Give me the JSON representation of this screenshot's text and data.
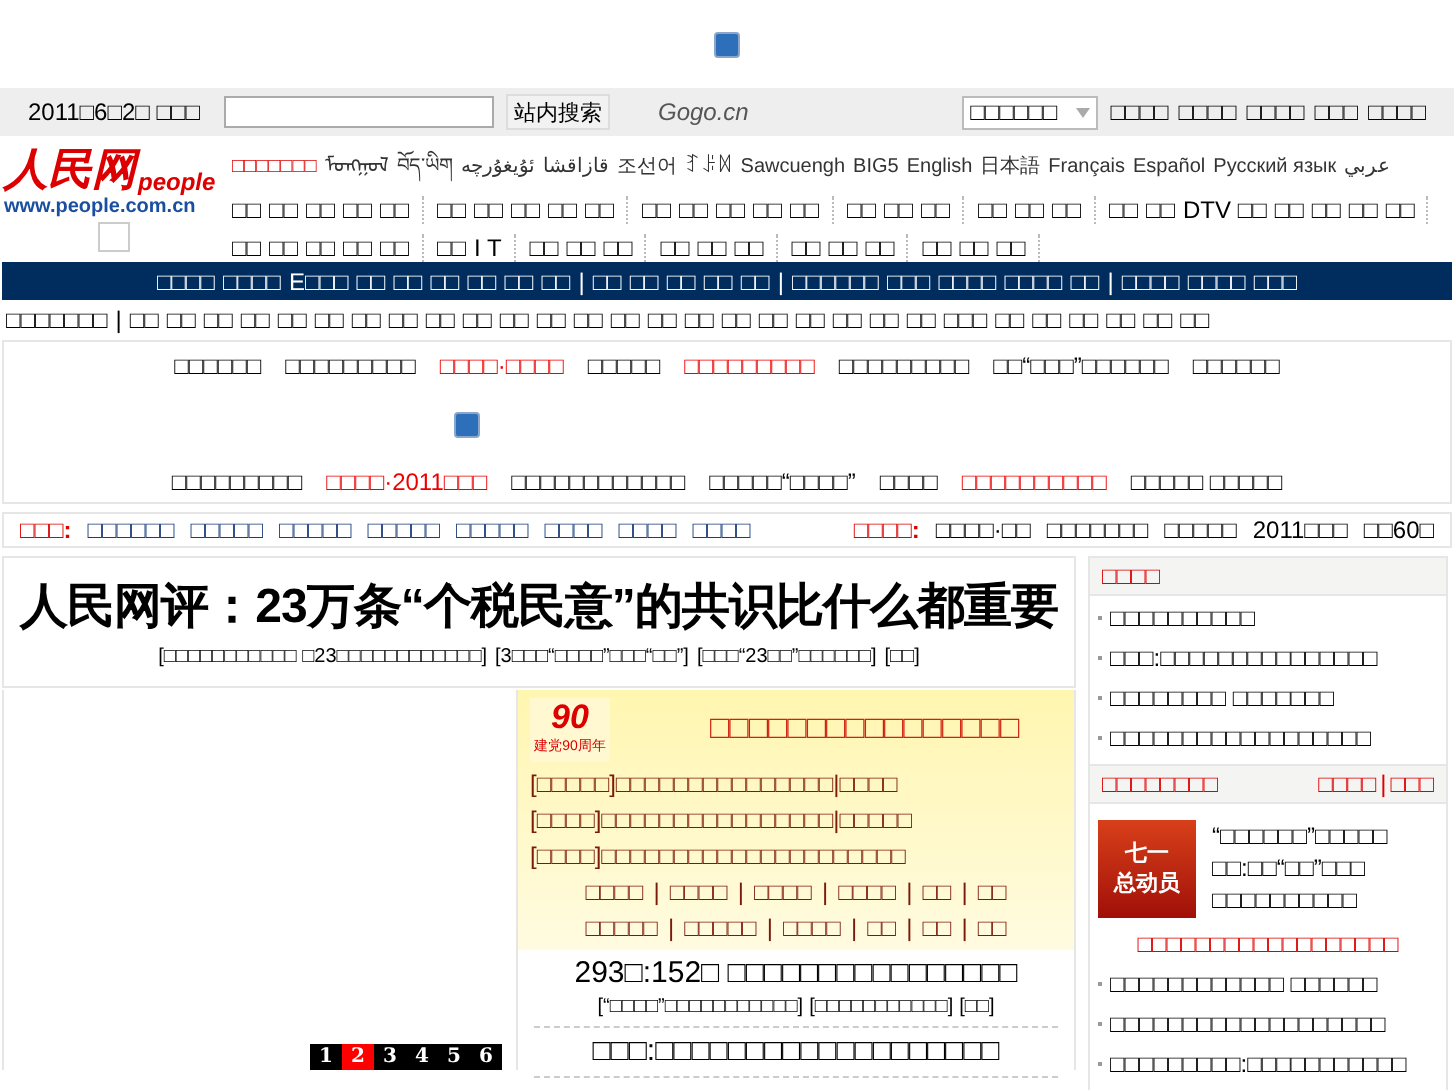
{
  "top_banner": {
    "broken_image": true
  },
  "utility_bar": {
    "date": "2011□6□2□ □□□",
    "search": {
      "button": "站内搜索"
    },
    "partner_logo": "Gogo.cn",
    "select": {
      "value": "□□□□□□"
    },
    "links": [
      "□□□□",
      "□□□□",
      "□□□□",
      "□□□",
      "□□□□"
    ]
  },
  "logo": {
    "name": "人民网",
    "brand": "people",
    "url": "www.people.com.cn"
  },
  "languages": [
    {
      "label": "□□□□□□□",
      "highlight": true
    },
    {
      "label": "ᠮᠣᠩᠭᠣᠯ",
      "highlight": false
    },
    {
      "label": "བོད་ཡིག",
      "highlight": false
    },
    {
      "label": "ئۇيغۇرچە",
      "highlight": false
    },
    {
      "label": "قازاقشا",
      "highlight": false
    },
    {
      "label": "조선어",
      "highlight": false
    },
    {
      "label": "ꆈꌠꉙ",
      "highlight": false
    },
    {
      "label": "Sawcuengh",
      "highlight": false
    },
    {
      "label": "BIG5",
      "highlight": false
    },
    {
      "label": "English",
      "highlight": false
    },
    {
      "label": "日本語",
      "highlight": false
    },
    {
      "label": "Français",
      "highlight": false
    },
    {
      "label": "Español",
      "highlight": false
    },
    {
      "label": "Русский язык",
      "highlight": false
    },
    {
      "label": "عربي",
      "highlight": false
    }
  ],
  "channel_nav": [
    [
      "□□",
      "□□",
      "□□",
      "□□",
      "□□"
    ],
    [
      "□□",
      "□□",
      "□□",
      "□□",
      "□□"
    ],
    [
      "□□",
      "□□",
      "□□",
      "□□",
      "□□"
    ],
    [
      "□□",
      "□□",
      "□□"
    ],
    [
      "□□",
      "□□",
      "□□"
    ],
    [
      "□□",
      "□□",
      "DTV □□",
      "□□",
      "□□",
      "□□",
      "□□"
    ],
    [
      "□□",
      "□□",
      "□□",
      "□□",
      "□□"
    ],
    [
      "□□",
      "I T"
    ],
    [
      "□□",
      "□□",
      "□□"
    ],
    [
      "□□",
      "□□",
      "□□"
    ],
    [
      "□□",
      "□□",
      "□□"
    ],
    [
      "□□",
      "□□",
      "□□"
    ]
  ],
  "separator": "|",
  "navy_bar": [
    [
      "□□□□",
      "□□□□",
      "E□□□",
      "□□",
      "□□",
      "□□",
      "□□",
      "□□",
      "□□"
    ],
    [
      "□□",
      "□□",
      "□□",
      "□□",
      "□□"
    ],
    [
      "□□□□□□",
      "□□□",
      "□□□□",
      "□□□□",
      "□□"
    ],
    [
      "□□□□",
      "□□□□",
      "□□□"
    ]
  ],
  "local_nav": {
    "label": "□□□□□□□",
    "links": [
      "□□",
      "□□",
      "□□",
      "□□",
      "□□",
      "□□",
      "□□",
      "□□",
      "□□",
      "□□",
      "□□",
      "□□",
      "□□",
      "□□",
      "□□",
      "□□",
      "□□",
      "□□",
      "□□",
      "□□",
      "□□",
      "□□",
      "□□□",
      "□□",
      "□□",
      "□□",
      "□□",
      "□□",
      "□□"
    ]
  },
  "promo_box": {
    "row_1": [
      {
        "label": "□□□□□□",
        "highlight": false
      },
      {
        "label": "□□□□□□□□□",
        "highlight": false
      },
      {
        "label": "□□□□·□□□□",
        "highlight": true
      },
      {
        "label": "□□□□□",
        "highlight": false
      },
      {
        "label": "□□□□□□□□□",
        "highlight": true
      },
      {
        "label": "□□□□□□□□□",
        "highlight": false
      },
      {
        "label": "□□“□□□”□□□□□□",
        "highlight": false
      },
      {
        "label": "□□□□□□",
        "highlight": false
      }
    ],
    "row_2": [
      {
        "label": "□□□□□□□□□",
        "highlight": false
      },
      {
        "label": "□□□□·2011□□□",
        "highlight": true
      },
      {
        "label": "□□□□□□□□□□□□",
        "highlight": false
      },
      {
        "label": "□□□□□“□□□□”",
        "highlight": false
      },
      {
        "label": "□□□□",
        "highlight": false
      },
      {
        "label": "□□□□□□□□□□",
        "highlight": true
      },
      {
        "label": "□□□□□ □□□□□",
        "highlight": false
      }
    ]
  },
  "hot_bar": {
    "label": "□□□:",
    "links": [
      "□□□□□□",
      "□□□□□",
      "□□□□□",
      "□□□□□",
      "□□□□□",
      "□□□□",
      "□□□□",
      "□□□□"
    ],
    "right_label": "□□□□:",
    "right_items": [
      "□□□□·□□",
      "□□□□□□□",
      "□□□□□",
      "2011□□□",
      "□□60□"
    ]
  },
  "headline": {
    "title": "人民网评：23万条“个税民意”的共识比什么都重要",
    "links": [
      "[□□□□□□□□□□□ □23□□□□□□□□□□□□]",
      "[3□□□“□□□□”□□□“□□”]",
      "[□□□“23□□”□□□□□□]",
      "[□□]"
    ]
  },
  "slideshow": {
    "pages": [
      {
        "label": "1",
        "selected": false
      },
      {
        "label": "2",
        "selected": true
      },
      {
        "label": "3",
        "selected": false
      },
      {
        "label": "4",
        "selected": false
      },
      {
        "label": "5",
        "selected": false
      },
      {
        "label": "6",
        "selected": false
      }
    ]
  },
  "party_panel": {
    "logo_number": "90",
    "logo_caption": "建党90周年",
    "title": "□□□□□□□□□□□□□□□□",
    "lines": [
      "[□□□□□]□□□□□□□□□□□□□□□|□□□□",
      "[□□□□]□□□□□□□□□□□□□□□□|□□□□□",
      "[□□□□]□□□□□□□□□□□□□□□□□□□□□"
    ],
    "link_rows": [
      [
        "□□□□",
        "□□□□",
        "□□□□",
        "□□□□",
        "□□",
        "□□"
      ],
      [
        "□□□□□",
        "□□□□□",
        "□□□□",
        "□□",
        "□□",
        "□□"
      ]
    ]
  },
  "news": [
    {
      "title": "293□:152□ □□□□□□□□□□□□□□□□",
      "links": [
        "[“□□□□”□□□□□□□□□□□]",
        "[□□□□□□□□□□□]",
        "[□□]"
      ]
    },
    {
      "title": "□□□:□□□□□□□□□□□□□□□□□□□"
    }
  ],
  "sidebar_1": {
    "title": "□□□□",
    "items": [
      "□□□□□□□□□□",
      "□□□:□□□□□□□□□□□□□□□",
      "□□□□□□□□ □□□□□□□",
      "□□□□□□□□□□□□□□□□□□"
    ]
  },
  "sidebar_2": {
    "title": "□□□□□□□□",
    "header_links": [
      "□□□□",
      "□□□"
    ],
    "banner": [
      "七一",
      "总动员"
    ],
    "feature": "“□□□□□□”□□□□□ □□:□□“□□”□□□ □□□□□□□□□□",
    "red_link": "□□□□□□□□□□□□□□□□□□",
    "items": [
      "□□□□□□□□□□□□ □□□□□□",
      "□□□□□□□□□□□□□□□□□□□",
      "□□□□□□□□□:□□□□□□□□□□□"
    ]
  }
}
